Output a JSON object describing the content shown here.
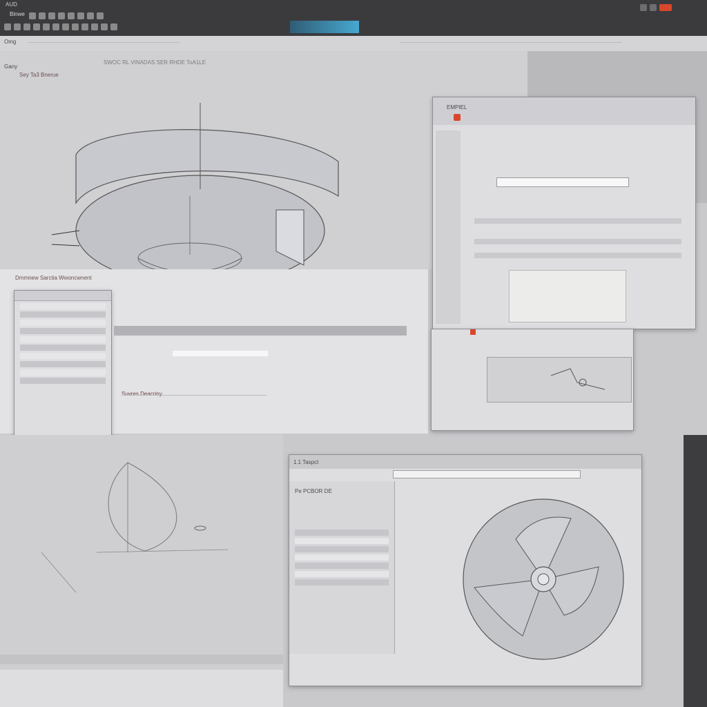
{
  "app": {
    "menu_left": "AUD",
    "brand": "Binwe",
    "status_left": "Omg",
    "status_tab": "Gany",
    "heading": "SWOC RL VINADAS SER RHDE ToA1LE"
  },
  "views": {
    "q1_label": "Sey Ta3 Bnerue",
    "q2_dialog_title": "EMPIEL",
    "q3_label": "Suvres Deacriny",
    "q4_title": "Dmmnew Sarctia Wwoncwnent",
    "q5_title": "1.1 Taspct",
    "q5_panel_label": "Pe PCBOR DE"
  },
  "colors": {
    "dark_bar": "#3b3b3e",
    "accent_red": "#d9472b",
    "accent_blue": "#47a8d1",
    "surface": "#c9c9cc"
  }
}
